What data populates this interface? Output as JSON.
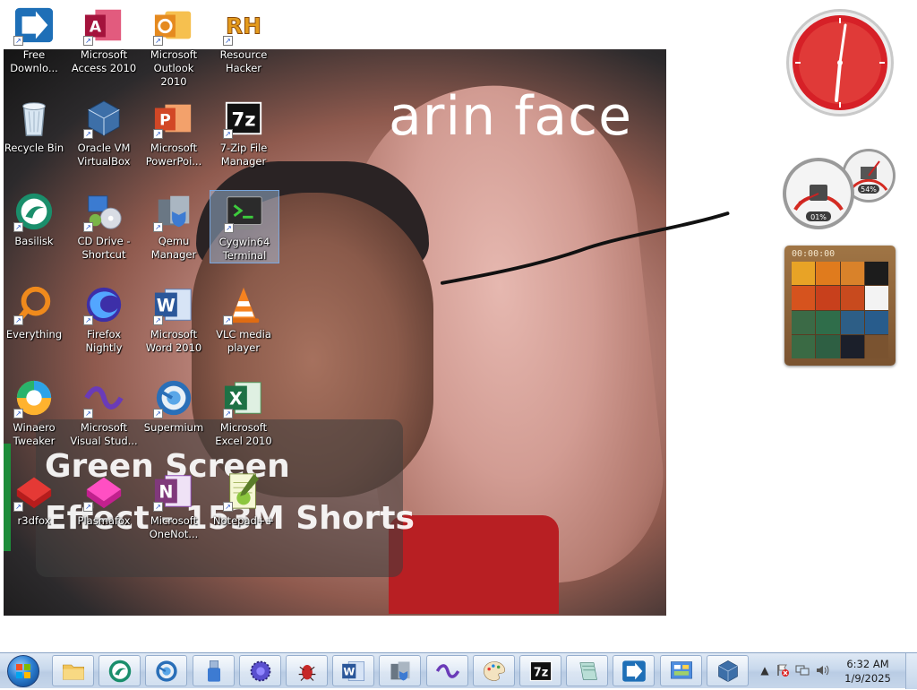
{
  "wallpaper": {
    "caption": "arin face",
    "overlay_line1": "Green Screen",
    "overlay_line2": "Effect - 153M Shorts"
  },
  "desktop": {
    "icons": [
      {
        "label": "Free Downlo...",
        "icon": "free-download-manager-icon"
      },
      {
        "label": "Microsoft Access 2010",
        "icon": "access-icon"
      },
      {
        "label": "Microsoft Outlook 2010",
        "icon": "outlook-icon"
      },
      {
        "label": "Resource Hacker",
        "icon": "resource-hacker-icon",
        "badge": "RH"
      },
      {
        "label": "Recycle Bin",
        "icon": "recycle-bin-icon"
      },
      {
        "label": "Oracle VM VirtualBox",
        "icon": "virtualbox-icon"
      },
      {
        "label": "Microsoft PowerPoi...",
        "icon": "powerpoint-icon"
      },
      {
        "label": "7-Zip File Manager",
        "icon": "seven-zip-icon",
        "badge": "7z"
      },
      {
        "label": "Basilisk",
        "icon": "basilisk-icon"
      },
      {
        "label": "CD Drive - Shortcut",
        "icon": "cd-drive-icon"
      },
      {
        "label": "Qemu Manager",
        "icon": "qemu-manager-icon"
      },
      {
        "label": "Cygwin64 Terminal",
        "icon": "cygwin-terminal-icon"
      },
      {
        "label": "Everything",
        "icon": "everything-search-icon"
      },
      {
        "label": "Firefox Nightly",
        "icon": "firefox-nightly-icon"
      },
      {
        "label": "Microsoft Word 2010",
        "icon": "word-icon",
        "badge": "W"
      },
      {
        "label": "VLC media player",
        "icon": "vlc-icon"
      },
      {
        "label": "Winaero Tweaker",
        "icon": "winaero-tweaker-icon"
      },
      {
        "label": "Microsoft Visual Stud...",
        "icon": "visual-studio-icon"
      },
      {
        "label": "Supermium",
        "icon": "supermium-icon"
      },
      {
        "label": "Microsoft Excel 2010",
        "icon": "excel-icon",
        "badge": "X"
      },
      {
        "label": "r3dfox",
        "icon": "r3dfox-icon"
      },
      {
        "label": "Plasmafox",
        "icon": "plasmafox-icon"
      },
      {
        "label": "Microsoft OneNot...",
        "icon": "onenote-icon",
        "badge": "N"
      },
      {
        "label": "Notepad++",
        "icon": "notepad-plus-plus-icon"
      }
    ]
  },
  "gadgets": {
    "cpu_meter": {
      "cpu": "01%",
      "memory": "54%"
    },
    "puzzle": {
      "timer": "00:00:00"
    }
  },
  "taskbar": {
    "pinned": [
      {
        "name": "windows-explorer",
        "icon": "folder-icon"
      },
      {
        "name": "basilisk",
        "icon": "basilisk-icon"
      },
      {
        "name": "supermium",
        "icon": "supermium-icon"
      },
      {
        "name": "usb-tool",
        "icon": "usb-icon"
      },
      {
        "name": "gear-app",
        "icon": "gear-ball-icon"
      },
      {
        "name": "bug-tool",
        "icon": "bug-icon"
      },
      {
        "name": "word",
        "icon": "word-icon",
        "badge": "W"
      },
      {
        "name": "qemu-manager",
        "icon": "qemu-manager-icon"
      },
      {
        "name": "visual-studio",
        "icon": "visual-studio-icon"
      },
      {
        "name": "paint",
        "icon": "paint-palette-icon"
      },
      {
        "name": "7zip",
        "icon": "seven-zip-icon",
        "badge": "7z"
      },
      {
        "name": "notepad-like",
        "icon": "window-icon"
      },
      {
        "name": "free-download-manager",
        "icon": "free-download-manager-icon"
      },
      {
        "name": "control-panel",
        "icon": "control-panel-icon"
      },
      {
        "name": "virtualbox",
        "icon": "virtualbox-icon"
      }
    ],
    "tray": {
      "time": "6:32 AM",
      "date": "1/9/2025"
    }
  },
  "colors": {
    "taskbar_top": "#dfe9f5",
    "clock_red": "#d62027",
    "meter_red": "#d42b22"
  }
}
